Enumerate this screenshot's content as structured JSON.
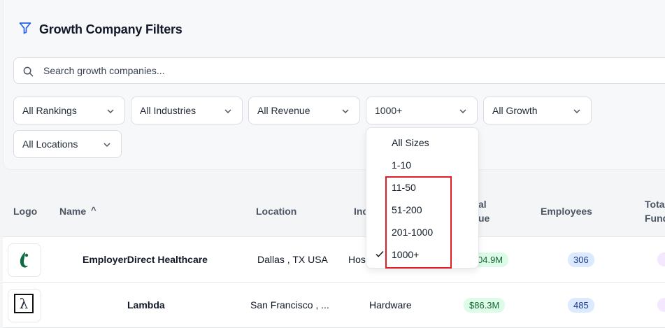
{
  "header": {
    "title": "Growth Company Filters",
    "icon": "filter-icon",
    "accent": "#2563eb"
  },
  "search": {
    "placeholder": "Search growth companies..."
  },
  "filters": [
    {
      "label": "All Rankings"
    },
    {
      "label": "All Industries"
    },
    {
      "label": "All Revenue"
    },
    {
      "label": "1000+"
    },
    {
      "label": "All Growth"
    },
    {
      "label": "All Locations"
    }
  ],
  "size_menu": {
    "options": [
      "All Sizes",
      "1-10",
      "11-50",
      "51-200",
      "201-1000",
      "1000+"
    ],
    "selected": "1000+",
    "highlight_color": "#e11d2a"
  },
  "table": {
    "headers": {
      "logo": "Logo",
      "name": "Name",
      "name_sort": "^",
      "location": "Location",
      "industry": "Ind",
      "revenue_1": "al",
      "revenue_2": "ue",
      "employees": "Employees",
      "funding_1": "Tota",
      "funding_2": "Fund"
    },
    "rows": [
      {
        "name": "EmployerDirect Healthcare",
        "location": "Dallas , TX USA",
        "industry": "Hos",
        "revenue": "04.9M",
        "employees": "306"
      },
      {
        "name": "Lambda",
        "location": "San Francisco , ...",
        "industry": "Hardware",
        "revenue": "$86.3M",
        "employees": "485",
        "logo_text": "λ"
      }
    ]
  }
}
